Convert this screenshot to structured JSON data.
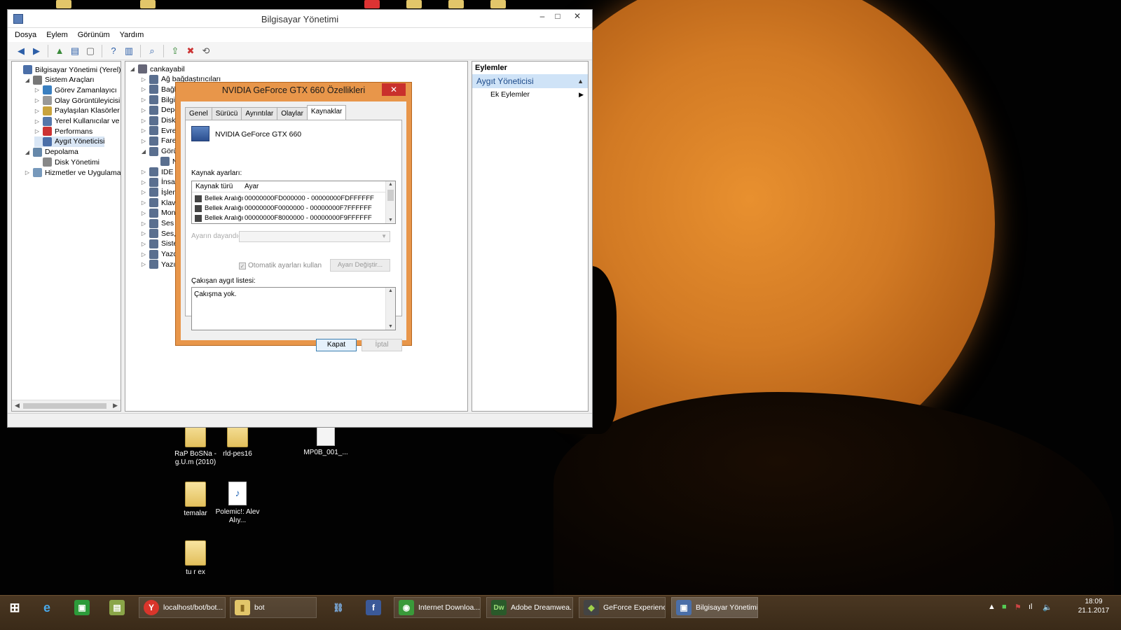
{
  "window": {
    "title": "Bilgisayar Yönetimi",
    "menu": [
      "Dosya",
      "Eylem",
      "Görünüm",
      "Yardım"
    ]
  },
  "left_tree": [
    {
      "label": "Bilgisayar Yönetimi (Yerel)",
      "depth": 0,
      "toggle": ""
    },
    {
      "label": "Sistem Araçları",
      "depth": 1,
      "toggle": "◢"
    },
    {
      "label": "Görev Zamanlayıcı",
      "depth": 2,
      "toggle": "▷"
    },
    {
      "label": "Olay Görüntüleyicisi",
      "depth": 2,
      "toggle": "▷"
    },
    {
      "label": "Paylaşılan Klasörler",
      "depth": 2,
      "toggle": "▷"
    },
    {
      "label": "Yerel Kullanıcılar ve Gru",
      "depth": 2,
      "toggle": "▷"
    },
    {
      "label": "Performans",
      "depth": 2,
      "toggle": "▷"
    },
    {
      "label": "Aygıt Yöneticisi",
      "depth": 2,
      "toggle": ""
    },
    {
      "label": "Depolama",
      "depth": 1,
      "toggle": "◢"
    },
    {
      "label": "Disk Yönetimi",
      "depth": 2,
      "toggle": ""
    },
    {
      "label": "Hizmetler ve Uygulamalar",
      "depth": 1,
      "toggle": "▷"
    }
  ],
  "mid_tree": [
    {
      "label": "cankayabil",
      "toggle": "◢",
      "root": true
    },
    {
      "label": "Ağ bağdaştırıcıları",
      "toggle": "▷"
    },
    {
      "label": "Bağla",
      "toggle": "▷"
    },
    {
      "label": "Bilgis",
      "toggle": "▷"
    },
    {
      "label": "Depo",
      "toggle": "▷"
    },
    {
      "label": "Disk s",
      "toggle": "▷"
    },
    {
      "label": "Evren",
      "toggle": "▷"
    },
    {
      "label": "Fare v",
      "toggle": "▷"
    },
    {
      "label": "Görün",
      "toggle": "◢"
    },
    {
      "label": "N",
      "toggle": "",
      "sub": true
    },
    {
      "label": "IDE A",
      "toggle": "▷"
    },
    {
      "label": "İnsan",
      "toggle": "▷"
    },
    {
      "label": "İşlem",
      "toggle": "▷"
    },
    {
      "label": "Klavy",
      "toggle": "▷"
    },
    {
      "label": "Moni",
      "toggle": "▷"
    },
    {
      "label": "Ses g",
      "toggle": "▷"
    },
    {
      "label": "Ses, v",
      "toggle": "▷"
    },
    {
      "label": "Sister",
      "toggle": "▷"
    },
    {
      "label": "Yazdı",
      "toggle": "▷"
    },
    {
      "label": "Yazılı",
      "toggle": "▷"
    }
  ],
  "actions": {
    "header": "Eylemler",
    "selected": "Aygıt Yöneticisi",
    "item": "Ek Eylemler"
  },
  "dialog": {
    "title": "NVIDIA GeForce GTX 660 Özellikleri",
    "close": "✕",
    "tabs": [
      "Genel",
      "Sürücü",
      "Ayrıntılar",
      "Olaylar",
      "Kaynaklar"
    ],
    "active_tab": "Kaynaklar",
    "device_name": "NVIDIA GeForce GTX 660",
    "resource_label": "Kaynak ayarları:",
    "columns": [
      "Kaynak türü",
      "Ayar"
    ],
    "resources": [
      {
        "type": "Bellek Aralığı",
        "value": "00000000FD000000 - 00000000FDFFFFFF"
      },
      {
        "type": "Bellek Aralığı",
        "value": "00000000F0000000 - 00000000F7FFFFFF"
      },
      {
        "type": "Bellek Aralığı",
        "value": "00000000F8000000 - 00000000F9FFFFFF"
      }
    ],
    "based_on_label": "Ayarın dayandığı:",
    "auto_settings": "Otomatik ayarları kullan",
    "change_setting": "Ayarı Değiştir...",
    "conflict_label": "Çakışan aygıt listesi:",
    "conflict_text": "Çakışma yok.",
    "ok": "Kapat",
    "cancel": "İptal"
  },
  "desktop_icons": [
    {
      "label": "RaP BoSNa - g.U.m (2010)",
      "kind": "folder"
    },
    {
      "label": "rld-pes16",
      "kind": "folder"
    },
    {
      "label": "MP0B_001_...",
      "kind": "file"
    },
    {
      "label": "temalar",
      "kind": "folder"
    },
    {
      "label": "Polemic!: Alev Alıy...",
      "kind": "mp3"
    },
    {
      "label": "tu r ex",
      "kind": "folder"
    }
  ],
  "taskbar": {
    "apps": [
      {
        "label": "localhost/bot/bot...",
        "icon": "Y",
        "color": "#d9352b"
      },
      {
        "label": "bot",
        "icon": "▮",
        "color": "#e2c66a"
      },
      {
        "label": "Internet Downloa...",
        "icon": "◉",
        "color": "#3a9a3a"
      },
      {
        "label": "Adobe Dreamwea...",
        "icon": "Dw",
        "color": "#2a5a2a"
      },
      {
        "label": "GeForce Experience",
        "icon": "◆",
        "color": "#555"
      },
      {
        "label": "Bilgisayar Yönetimi",
        "icon": "▣",
        "color": "#4b6fa8"
      }
    ],
    "time": "18:09",
    "date": "21.1.2017"
  }
}
